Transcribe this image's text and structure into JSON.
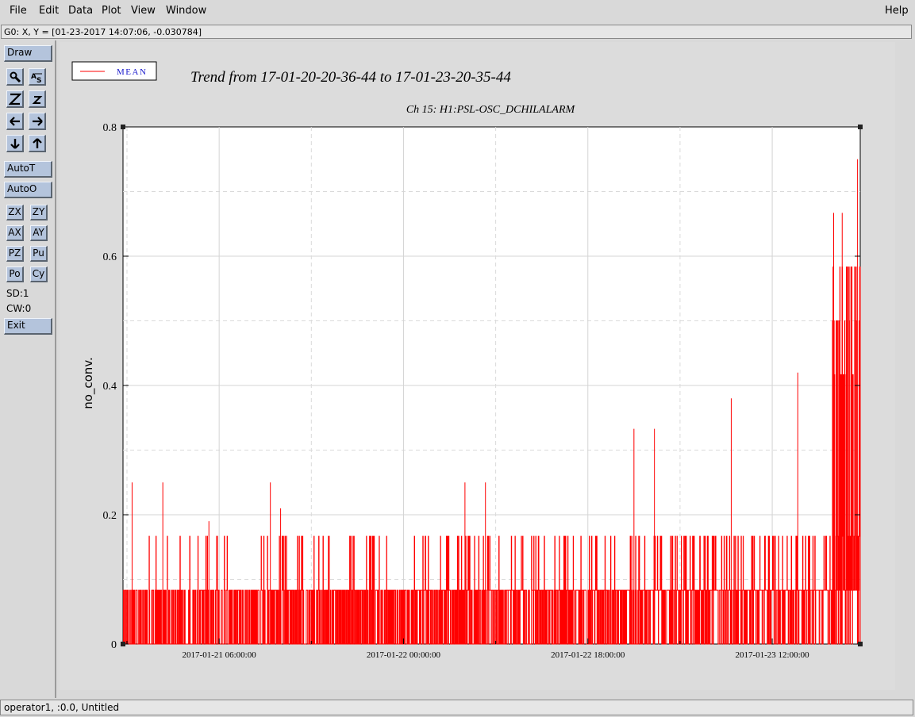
{
  "menu": {
    "file": "File",
    "edit": "Edit",
    "data": "Data",
    "plot": "Plot",
    "view": "View",
    "window": "Window",
    "help": "Help"
  },
  "status_line": "G0: X, Y = [01-23-2017 14:07:06, -0.030784]",
  "toolbar": {
    "draw": "Draw",
    "autot": "AutoT",
    "autoo": "AutoO",
    "zx": "ZX",
    "zy": "ZY",
    "ax": "AX",
    "ay": "AY",
    "pz": "PZ",
    "pu": "Pu",
    "po": "Po",
    "cy": "Cy",
    "sd": "SD:1",
    "cw": "CW:0",
    "exit": "Exit",
    "icons": [
      "magnify-icon",
      "axes-scale-icon",
      "zoom-z-icon",
      "zoom-small-z-icon",
      "arrow-left-icon",
      "arrow-right-icon",
      "arrow-down-icon",
      "arrow-up-icon"
    ]
  },
  "bottom_status": "operator1, :0.0, Untitled",
  "colors": {
    "series": "#ff0000",
    "legend_text": "#1a1acc",
    "button": "#b4c4dc"
  },
  "chart_data": {
    "type": "line",
    "title": "Trend from 17-01-20-20-36-44 to 17-01-23-20-35-44",
    "subtitle": "Ch 15: H1:PSL-OSC_DCHILALARM",
    "ylabel": "no_conv.",
    "xlabel": "",
    "x_range": [
      "2017-01-20 20:36:44",
      "2017-01-23 20:35:44"
    ],
    "ylim": [
      0,
      0.8
    ],
    "y_ticks": [
      "0",
      "0.2",
      "0.4",
      "0.6",
      "0.8"
    ],
    "x_ticks": [
      {
        "time": "2017-01-21 06:00:00",
        "label": "2017-01-21 06:00:00"
      },
      {
        "time": "2017-01-22 00:00:00",
        "label": "2017-01-22 00:00:00"
      },
      {
        "time": "2017-01-22 18:00:00",
        "label": "2017-01-22 18:00:00"
      },
      {
        "time": "2017-01-23 12:00:00",
        "label": "2017-01-23 12:00:00"
      }
    ],
    "grid": true,
    "legend": {
      "placement": "top-left",
      "entries": [
        "MEAN"
      ]
    },
    "series": [
      {
        "name": "MEAN",
        "color": "#ff0000",
        "description_levels": [
          0,
          0.0833,
          0.1667,
          0.25,
          0.3333,
          0.4167,
          0.5,
          0.5833,
          0.6667,
          0.75
        ],
        "peaks": [
          {
            "time": "2017-01-20 21:30:00",
            "value": 0.25
          },
          {
            "time": "2017-01-21 00:30:00",
            "value": 0.25
          },
          {
            "time": "2017-01-21 05:00:00",
            "value": 0.19
          },
          {
            "time": "2017-01-21 11:00:00",
            "value": 0.25
          },
          {
            "time": "2017-01-21 12:00:00",
            "value": 0.21
          },
          {
            "time": "2017-01-22 06:00:00",
            "value": 0.25
          },
          {
            "time": "2017-01-22 08:00:00",
            "value": 0.25
          },
          {
            "time": "2017-01-22 22:30:00",
            "value": 0.333
          },
          {
            "time": "2017-01-23 00:30:00",
            "value": 0.333
          },
          {
            "time": "2017-01-23 08:00:00",
            "value": 0.38
          },
          {
            "time": "2017-01-23 14:30:00",
            "value": 0.42
          },
          {
            "time": "2017-01-23 18:00:00",
            "value": 0.667
          },
          {
            "time": "2017-01-23 18:50:00",
            "value": 0.667
          },
          {
            "time": "2017-01-23 20:20:00",
            "value": 0.75
          }
        ]
      }
    ]
  }
}
